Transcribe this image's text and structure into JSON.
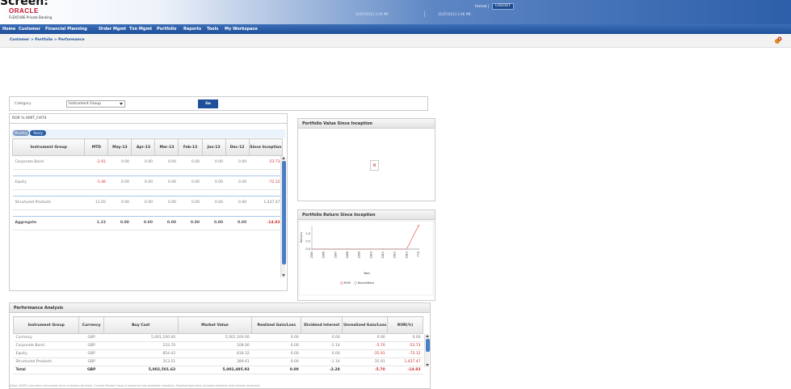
{
  "page": {
    "caption": "Screen:"
  },
  "header": {
    "logo": "ORACLE",
    "subtitle": "FLEXCUBE Private Banking",
    "user": "Hemal |",
    "logout_label": "LOGOUT",
    "date_left": "31/07/2013 2:29 PM",
    "date_right": "31/07/2013 2:46 PM"
  },
  "nav": {
    "items": [
      "Home",
      "Customer",
      "Financial Planning",
      "Order Mgmt",
      "Txn Mgmt",
      "Portfolio",
      "Reports",
      "Tools",
      "My Workspace"
    ]
  },
  "breadcrumb": "Customer > Portfolio > Performance",
  "filter": {
    "category_label": "Category",
    "category_value": "Instrument Group",
    "go_label": "Go"
  },
  "ror": {
    "title": "ROR % AMIT_FIAT4",
    "toggles": [
      "Monthly",
      "Yearly"
    ],
    "columns": [
      "Instrument Group",
      "MTD",
      "May-13",
      "Apr-13",
      "Mar-13",
      "Feb-13",
      "Jan-13",
      "Dec-12",
      "Since Inception"
    ],
    "rows": [
      {
        "name": "Corporate Bond",
        "vals": [
          "-2.91",
          "0.00",
          "0.00",
          "0.00",
          "0.00",
          "0.00",
          "0.00",
          "-53.73"
        ]
      },
      {
        "name": "Equity",
        "vals": [
          "-1.46",
          "0.00",
          "0.00",
          "0.00",
          "0.00",
          "0.00",
          "0.00",
          "-72.12"
        ]
      },
      {
        "name": "Structured Products",
        "vals": [
          "11.05",
          "0.00",
          "0.00",
          "0.00",
          "0.00",
          "0.00",
          "0.00",
          "1,437.47"
        ]
      }
    ],
    "aggregate": {
      "name": "Aggregate",
      "vals": [
        "1.23",
        "0.00",
        "0.00",
        "0.00",
        "0.00",
        "0.00",
        "0.00",
        "-14.83"
      ]
    }
  },
  "pv_panel": {
    "title": "Portfolio Value Since Inception",
    "broken_image_glyph": "×"
  },
  "pr_panel": {
    "title": "Portfolio Return Since Inception"
  },
  "chart_data": {
    "type": "line",
    "x": [
      "2005",
      "2006",
      "2007",
      "2008",
      "2009",
      "2010",
      "2011",
      "2012",
      "2013",
      "YTD"
    ],
    "series": [
      {
        "name": "ROR",
        "values": [
          0,
          0,
          0,
          0,
          0,
          0,
          0,
          0,
          0,
          1.9
        ]
      },
      {
        "name": "BenchMark",
        "values": [
          0,
          0,
          0,
          0,
          0,
          0,
          0,
          0,
          0,
          0
        ]
      }
    ],
    "yticks": [
      "1.0",
      "0.5",
      "0.0"
    ],
    "xlabel": "Year",
    "ylabel": "Returns",
    "ylim": [
      0,
      1.5
    ],
    "legend_position": "bottom",
    "colors": {
      "ROR": "#e53935",
      "BenchMark": "#9e9e9e"
    }
  },
  "performance": {
    "title": "Performance Analysis",
    "columns": [
      "Instrument Group",
      "Currency",
      "Buy Cost",
      "Market Value",
      "Realized Gain/Loss",
      "Dividend Interest",
      "Unrealized Gain/Loss",
      "ROR(%)"
    ],
    "rows": [
      [
        "Currency",
        "GBP",
        "5,001,100.00",
        "5,001,100.00",
        "0.00",
        "0.00",
        "0.00",
        "0.00"
      ],
      [
        "Corporate Bond",
        "GBP",
        "233.70",
        "108.00",
        "0.00",
        "-1.14",
        "-5.70",
        "-53.73"
      ],
      [
        "Equity",
        "GBP",
        "854.42",
        "818.32",
        "0.00",
        "0.00",
        "-35.91",
        "-72.12"
      ],
      [
        "Structured Products",
        "GBP",
        "313.51",
        "389.61",
        "0.00",
        "-1.14",
        "35.91",
        "1,437.47"
      ]
    ],
    "negative_cols": [
      6,
      7
    ],
    "total": [
      "Total",
      "GBP",
      "5,002,501.63",
      "5,002,495.93",
      "0.00",
      "-2.28",
      "-5.70",
      "-14.83"
    ],
    "note": "(Note: ROR% has been calculated since inception timeline. Current Market value is based on last available valuation. Realised gain/loss includes dividend and interest received)"
  },
  "colors": {
    "brand": "#c8102e",
    "nav": "#1e4f9a",
    "negative": "#d32f2f",
    "accent": "#2b5fa6"
  }
}
